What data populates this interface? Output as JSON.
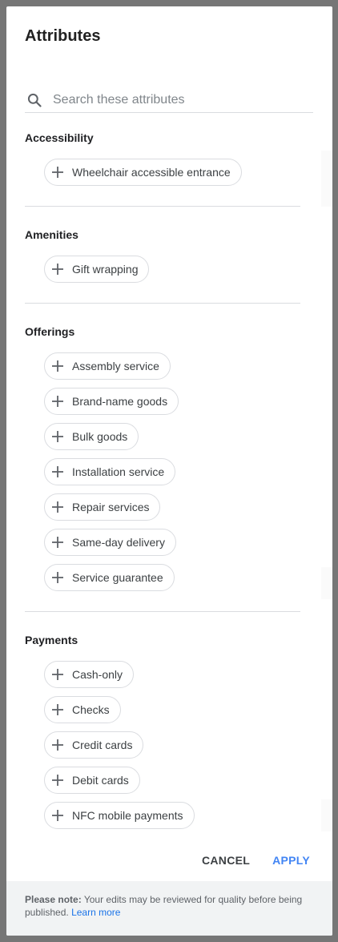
{
  "dialog": {
    "title": "Attributes",
    "search_placeholder": "Search these attributes"
  },
  "sections": {
    "accessibility": {
      "title": "Accessibility",
      "items": [
        "Wheelchair accessible entrance"
      ]
    },
    "amenities": {
      "title": "Amenities",
      "items": [
        "Gift wrapping"
      ]
    },
    "offerings": {
      "title": "Offerings",
      "items": [
        "Assembly service",
        "Brand-name goods",
        "Bulk goods",
        "Installation service",
        "Repair services",
        "Same-day delivery",
        "Service guarantee"
      ]
    },
    "payments": {
      "title": "Payments",
      "items": [
        "Cash-only",
        "Checks",
        "Credit cards",
        "Debit cards",
        "NFC mobile payments"
      ]
    }
  },
  "actions": {
    "cancel_label": "CANCEL",
    "apply_label": "APPLY"
  },
  "footer": {
    "note_label": "Please note:",
    "note_text": "Your edits may be reviewed for quality before being published.",
    "link_label": "Learn more"
  },
  "colors": {
    "accent": "#4285f4",
    "backdrop": "#767676",
    "footer_bg": "#f1f3f4"
  },
  "icons": {
    "search": "search-icon",
    "add": "plus-icon"
  }
}
